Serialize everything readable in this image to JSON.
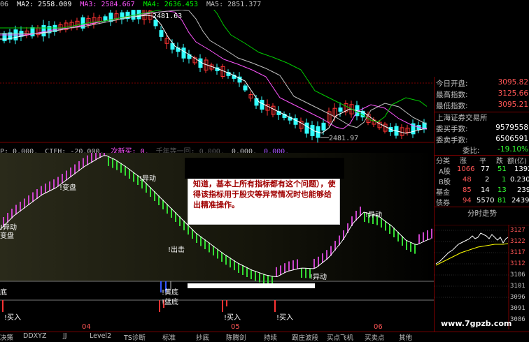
{
  "header": {
    "prefix": "06",
    "ma2": "MA2: 2558.009",
    "ma3": "MA3: 2584.667",
    "ma4": "MA4: 2636.453",
    "ma5": "MA5: 2851.377",
    "colors": {
      "ma2": "#ffffff",
      "ma3": "#ff55ff",
      "ma4": "#00ff00",
      "ma5": "#c0c0c0",
      "bull": "#ff3333",
      "bear": "#33ffff"
    }
  },
  "chart": {
    "high_label": "2481.63",
    "low_label": "2481.97"
  },
  "indicator_header": {
    "p": "P: 0.000,",
    "cifh": "CIFH: -20.000,",
    "new_buy": "次新买: 0,",
    "qnd": "千年等一回: 0.000,",
    "v1": "0.000,",
    "v2": "0.000,"
  },
  "annotations": {
    "bian_pan_1": "!变盘",
    "bian_pan_2": "!变盘",
    "bian_pan_3": "变盘",
    "yi_dong_1": "!异动",
    "yi_dong_2": "!异动",
    "yi_dong_3": "!异动",
    "yi_dong_4": "!异动",
    "chu_ji": "!出击",
    "huang_di": "!黄底",
    "lan_di": "!蓝底",
    "di": "底",
    "buy_1": "!买入",
    "buy_2": "!买入",
    "buy_3": "!买入"
  },
  "note": {
    "text": "知道，基本上所有指标都有这个问题），使得该指标用于股灾等异常情况时也能够给出精准操作。"
  },
  "panel": {
    "rows": [
      {
        "k": "今日开盘:",
        "v": "3095.82",
        "c": "#ff5555"
      },
      {
        "k": "最高指数:",
        "v": "3125.66",
        "c": "#ff5555"
      },
      {
        "k": "最低指数:",
        "v": "3095.21",
        "c": "#ff5555"
      },
      {
        "k": "上海证券交易所",
        "v": "",
        "c": "#c0c0c0"
      },
      {
        "k": "委买手数:",
        "v": "9579558",
        "c": "#ffffff"
      },
      {
        "k": "委卖手数:",
        "v": "6506591",
        "c": "#ffffff"
      },
      {
        "k": "委比:",
        "v": "-19.10%",
        "c": "#33ff33"
      }
    ],
    "table_header": [
      "分类",
      "涨",
      "平",
      "跌",
      "额(亿)"
    ],
    "table_rows": [
      [
        "A股",
        "1066",
        "77",
        "51",
        "1392"
      ],
      [
        "B股",
        "48",
        "2",
        "1",
        "0.230"
      ],
      [
        "基金",
        "85",
        "14",
        "13",
        "239"
      ],
      [
        "债券",
        "94",
        "5570",
        "81",
        "2439"
      ]
    ],
    "mini_title": "分时走势",
    "mini_prices": [
      "3127",
      "3122",
      "3117",
      "3112",
      "3106",
      "3101",
      "3096",
      "3091",
      "3086"
    ]
  },
  "bottom": {
    "date_04": "04",
    "date_05": "05",
    "date_06": "06",
    "buttons": [
      "决策",
      "DDXYZ",
      "JJ",
      "Level2",
      "TS诊断",
      "标准",
      "抄底",
      "陈腾剑",
      "持续",
      "跟庄波段",
      "买点飞机",
      "买卖点",
      "其他"
    ]
  },
  "watermark": "www.7gpzb.com"
}
